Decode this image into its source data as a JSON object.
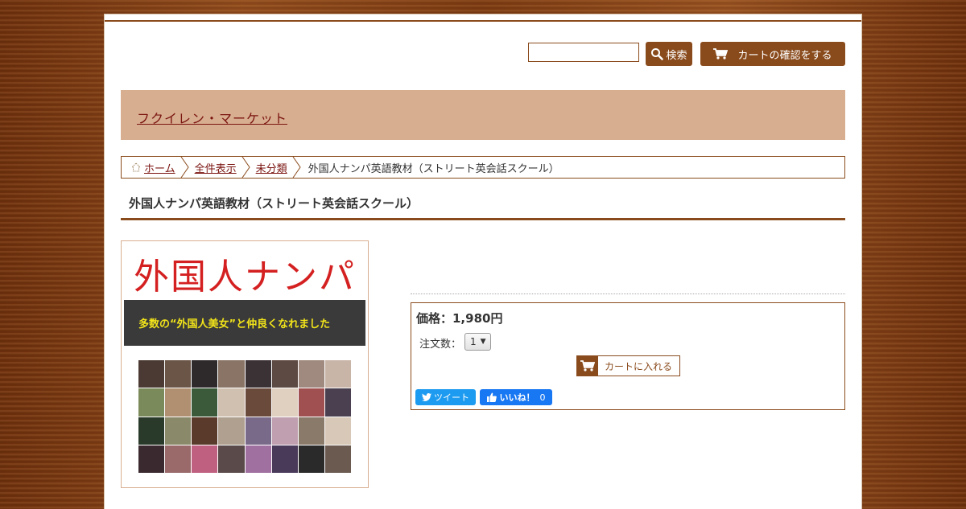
{
  "search": {
    "placeholder": "",
    "button_label": "検索"
  },
  "cart": {
    "view_label": "カートの確認をする"
  },
  "shop": {
    "name": "フクイレン・マーケット"
  },
  "breadcrumb": {
    "items": [
      "ホーム",
      "全件表示",
      "未分類"
    ],
    "current": "外国人ナンパ英語教材（ストリート英会話スクール）"
  },
  "product": {
    "title": "外国人ナンパ英語教材（ストリート英会話スクール）",
    "image": {
      "headline": "外国人ナンパ",
      "tagline": "多数の“外国人美女”と仲良くなれました"
    },
    "price_text": "価格：1,980円",
    "quantity_label": "注文数：",
    "quantity_value": "1",
    "add_to_cart_label": "カートに入れる"
  },
  "social": {
    "tweet_label": "ツイート",
    "like_label": "いいね！",
    "like_count": "0"
  },
  "colors": {
    "accent_brown": "#8a4b1c",
    "banner_tan": "#d8ae90",
    "link_red": "#7a1410",
    "twitter_blue": "#1d9bf0",
    "facebook_blue": "#1877f2"
  },
  "icons": [
    "search-icon",
    "cart-icon",
    "home-icon",
    "twitter-icon",
    "thumbs-up-icon",
    "chevron-down-icon"
  ]
}
